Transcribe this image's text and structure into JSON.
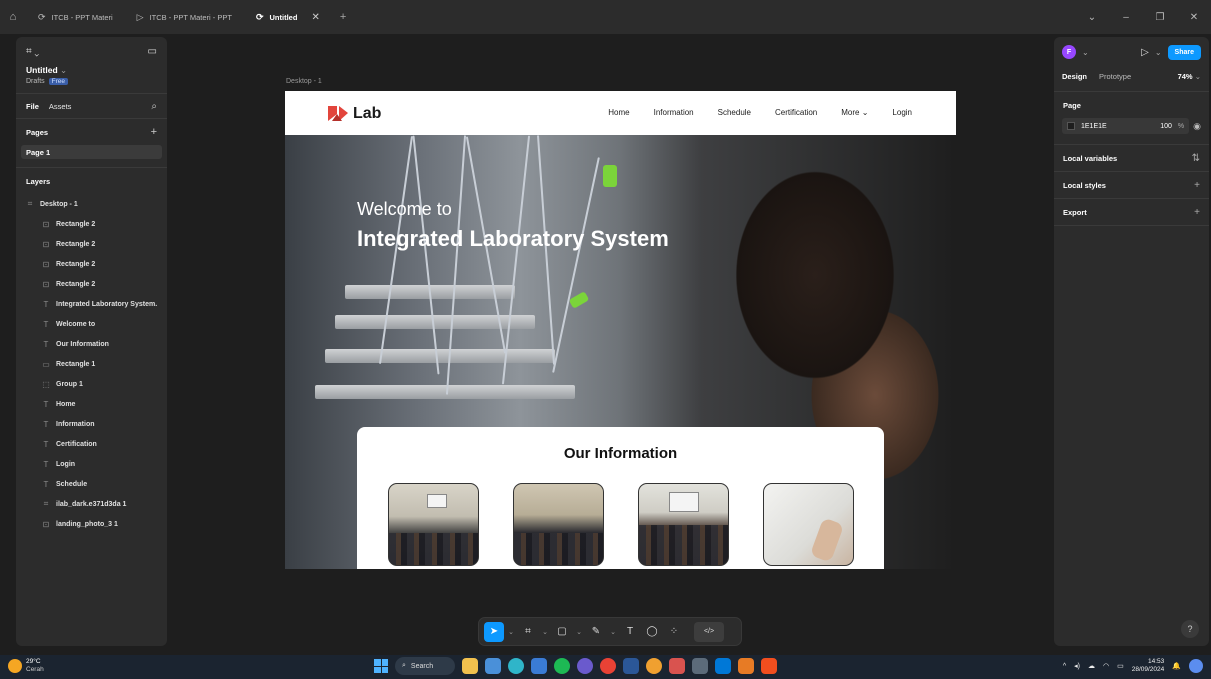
{
  "titlebar": {
    "tabs": [
      {
        "label": "ITCB - PPT Materi"
      },
      {
        "label": "ITCB - PPT Materi - PPT"
      },
      {
        "label": "Untitled"
      }
    ]
  },
  "left_panel": {
    "doc_title": "Untitled",
    "doc_location": "Drafts",
    "plan_badge": "Free",
    "file_tab": "File",
    "assets_tab": "Assets",
    "pages_header": "Pages",
    "page_1": "Page 1",
    "layers_header": "Layers",
    "layers": [
      {
        "label": "Desktop - 1"
      },
      {
        "label": "Rectangle 2"
      },
      {
        "label": "Rectangle 2"
      },
      {
        "label": "Rectangle 2"
      },
      {
        "label": "Rectangle 2"
      },
      {
        "label": "Integrated Laboratory System."
      },
      {
        "label": "Welcome to"
      },
      {
        "label": "Our Information"
      },
      {
        "label": "Rectangle 1"
      },
      {
        "label": "Group 1"
      },
      {
        "label": "Home"
      },
      {
        "label": "Information"
      },
      {
        "label": "Certification"
      },
      {
        "label": "Login"
      },
      {
        "label": "Schedule"
      },
      {
        "label": "ilab_dark.e371d3da 1"
      },
      {
        "label": "landing_photo_3 1"
      }
    ]
  },
  "canvas": {
    "frame_label": "Desktop - 1",
    "logo_text": "Lab",
    "nav": [
      "Home",
      "Information",
      "Schedule",
      "Certification",
      "More",
      "Login"
    ],
    "hero_line1": "Welcome to",
    "hero_line2": "Integrated Laboratory System",
    "info_title": "Our Information"
  },
  "right_panel": {
    "avatar_letter": "F",
    "share_label": "Share",
    "design_tab": "Design",
    "prototype_tab": "Prototype",
    "zoom": "74%",
    "page_header": "Page",
    "page_color_hex": "1E1E1E",
    "page_opacity": "100",
    "opacity_unit": "%",
    "local_variables": "Local variables",
    "local_styles": "Local styles",
    "export": "Export",
    "help": "?"
  },
  "taskbar": {
    "temperature": "29°C",
    "weather": "Cerah",
    "search_label": "Search",
    "time": "14:53",
    "date": "28/09/2024"
  },
  "colors": {
    "accent": "#0d99ff",
    "page_bg": "#1e1e1e",
    "panel_bg": "#2c2c2c",
    "logo_red": "#e2453c"
  }
}
